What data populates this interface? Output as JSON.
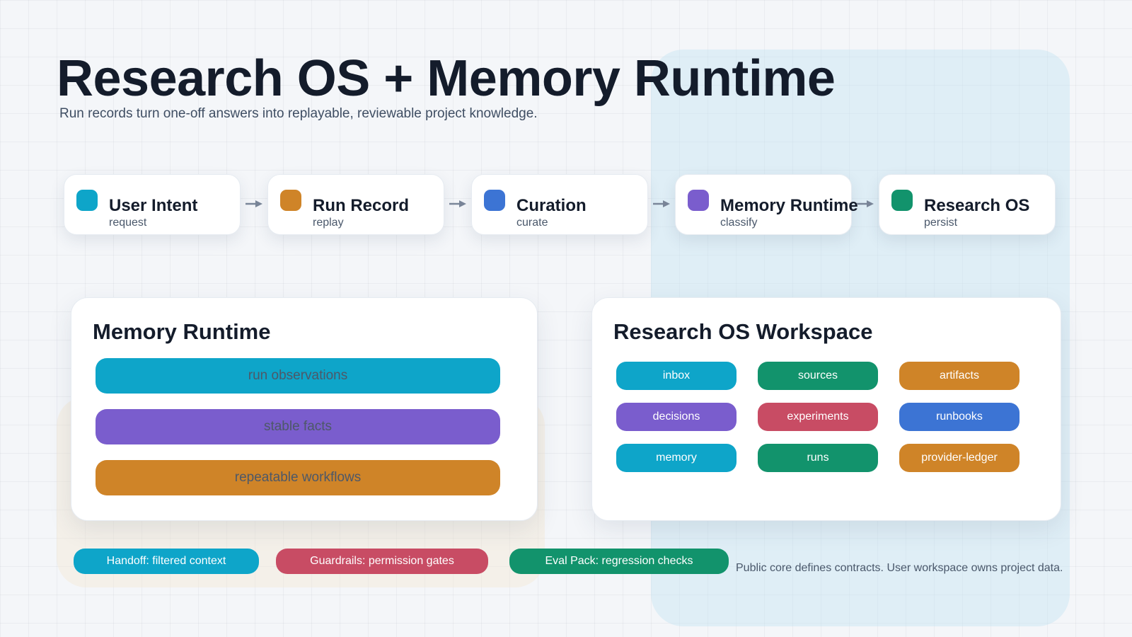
{
  "title": "Research OS + Memory Runtime",
  "subtitle": "Run records turn one-off answers into replayable, reviewable project knowledge.",
  "colors": {
    "cyan": "#0ea5c9",
    "orange": "#cf8428",
    "blue": "#3c74d4",
    "purple": "#7a5dcd",
    "green": "#12936c",
    "red": "#c84c64",
    "arrow": "#7a8699"
  },
  "flow": {
    "nodes": [
      {
        "title": "User Intent",
        "sub": "request",
        "color": "cyan"
      },
      {
        "title": "Run Record",
        "sub": "replay",
        "color": "orange"
      },
      {
        "title": "Curation",
        "sub": "curate",
        "color": "blue"
      },
      {
        "title": "Memory Runtime",
        "sub": "classify",
        "color": "purple"
      },
      {
        "title": "Research OS",
        "sub": "persist",
        "color": "green"
      }
    ]
  },
  "memory_panel": {
    "title": "Memory Runtime",
    "bars": [
      {
        "label": "run observations",
        "color": "cyan"
      },
      {
        "label": "stable facts",
        "color": "purple"
      },
      {
        "label": "repeatable workflows",
        "color": "orange"
      }
    ]
  },
  "workspace_panel": {
    "title": "Research OS Workspace",
    "chips": [
      {
        "label": "inbox",
        "color": "cyan"
      },
      {
        "label": "sources",
        "color": "green"
      },
      {
        "label": "artifacts",
        "color": "orange"
      },
      {
        "label": "decisions",
        "color": "purple"
      },
      {
        "label": "experiments",
        "color": "red"
      },
      {
        "label": "runbooks",
        "color": "blue"
      },
      {
        "label": "memory",
        "color": "cyan"
      },
      {
        "label": "runs",
        "color": "green"
      },
      {
        "label": "provider-ledger",
        "color": "orange"
      }
    ]
  },
  "pills": [
    {
      "label": "Handoff: filtered context",
      "color": "cyan"
    },
    {
      "label": "Guardrails: permission gates",
      "color": "red"
    },
    {
      "label": "Eval Pack: regression checks",
      "color": "green"
    }
  ],
  "footnote": "Public core defines contracts. User workspace owns project data."
}
